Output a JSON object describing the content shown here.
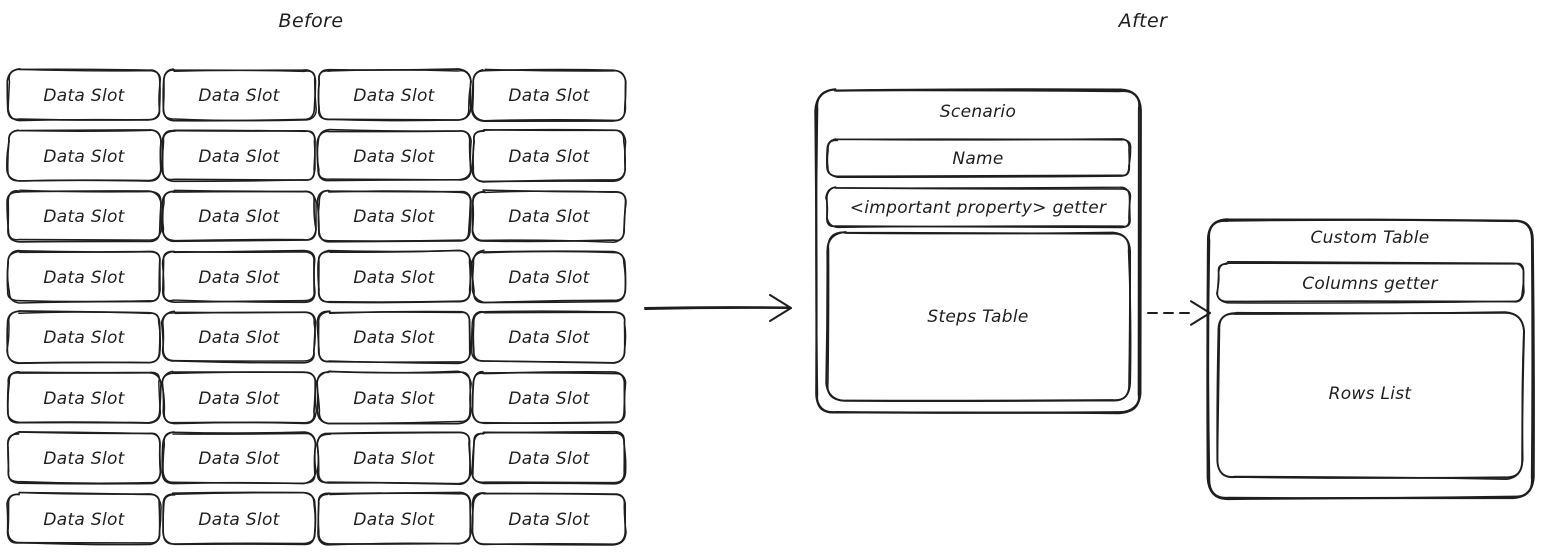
{
  "titles": {
    "before": "Before",
    "after": "After"
  },
  "before_grid": {
    "cell_label": "Data Slot",
    "columns": 4,
    "rows": 8,
    "cells": [
      [
        "Data Slot",
        "Data Slot",
        "Data Slot",
        "Data Slot"
      ],
      [
        "Data Slot",
        "Data Slot",
        "Data Slot",
        "Data Slot"
      ],
      [
        "Data Slot",
        "Data Slot",
        "Data Slot",
        "Data Slot"
      ],
      [
        "Data Slot",
        "Data Slot",
        "Data Slot",
        "Data Slot"
      ],
      [
        "Data Slot",
        "Data Slot",
        "Data Slot",
        "Data Slot"
      ],
      [
        "Data Slot",
        "Data Slot",
        "Data Slot",
        "Data Slot"
      ],
      [
        "Data Slot",
        "Data Slot",
        "Data Slot",
        "Data Slot"
      ],
      [
        "Data Slot",
        "Data Slot",
        "Data Slot",
        "Data Slot"
      ]
    ]
  },
  "after": {
    "scenario": {
      "title": "Scenario",
      "name_field": "Name",
      "property_getter": "<important property> getter",
      "steps_table": "Steps Table"
    },
    "custom_table": {
      "title": "Custom Table",
      "columns_getter": "Columns getter",
      "rows_list": "Rows List"
    }
  },
  "connectors": {
    "transform_arrow": "solid-arrow-right",
    "reference_arrow": "dashed-arrow-right"
  },
  "colors": {
    "stroke": "#1e1e1e",
    "background": "#ffffff",
    "text": "#1e1e1e"
  }
}
